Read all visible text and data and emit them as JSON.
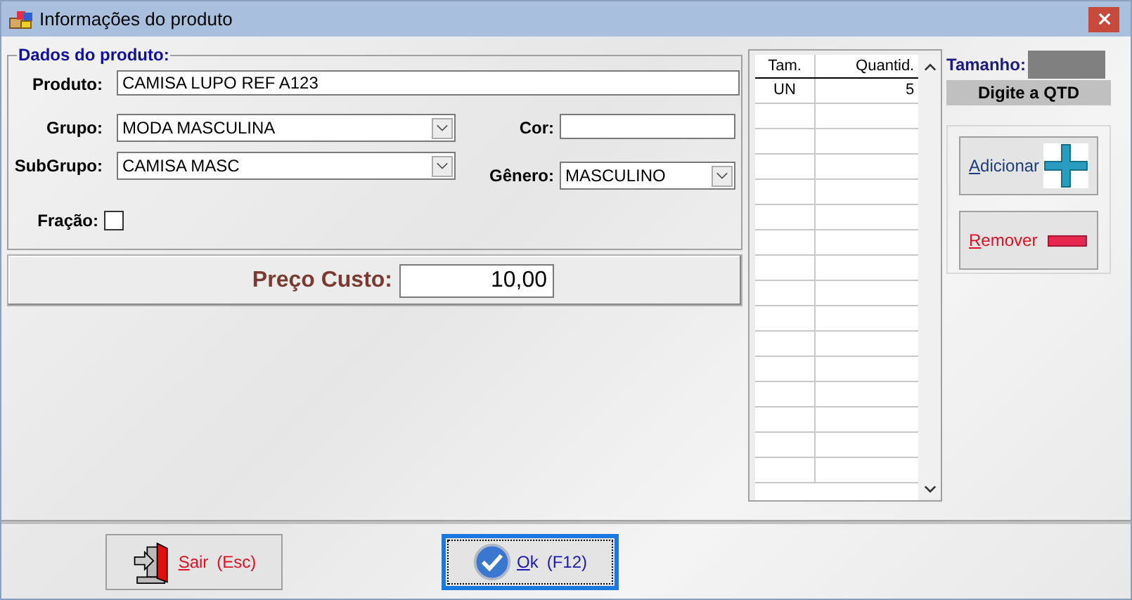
{
  "window": {
    "title": "Informações do produto"
  },
  "group": {
    "title": "Dados do produto:",
    "produto": {
      "label": "Produto:",
      "value": "CAMISA LUPO REF A123"
    },
    "grupo": {
      "label": "Grupo:",
      "value": "MODA MASCULINA"
    },
    "subgrupo": {
      "label": "SubGrupo:",
      "value": "CAMISA MASC"
    },
    "cor": {
      "label": "Cor:"
    },
    "genero": {
      "label": "Gênero:",
      "value": "MASCULINO"
    },
    "fracao": {
      "label": "Fração:",
      "checked": false
    }
  },
  "price": {
    "label": "Preço Custo:",
    "value": "10,00"
  },
  "table": {
    "columns": [
      "Tam.",
      "Quantid."
    ],
    "rows": [
      [
        "UN",
        "5"
      ]
    ]
  },
  "size": {
    "label": "Tamanho:",
    "hint": "Digite a QTD"
  },
  "side_buttons": [
    {
      "kind": "add",
      "label": "Adicionar"
    },
    {
      "kind": "remove",
      "label": "Remover"
    }
  ],
  "bottom_buttons": [
    {
      "kind": "exit",
      "label": "Sair",
      "shortcut": "(Esc)",
      "focused": false
    },
    {
      "kind": "ok",
      "label": "Ok",
      "shortcut": "(F12)",
      "focused": true
    }
  ]
}
